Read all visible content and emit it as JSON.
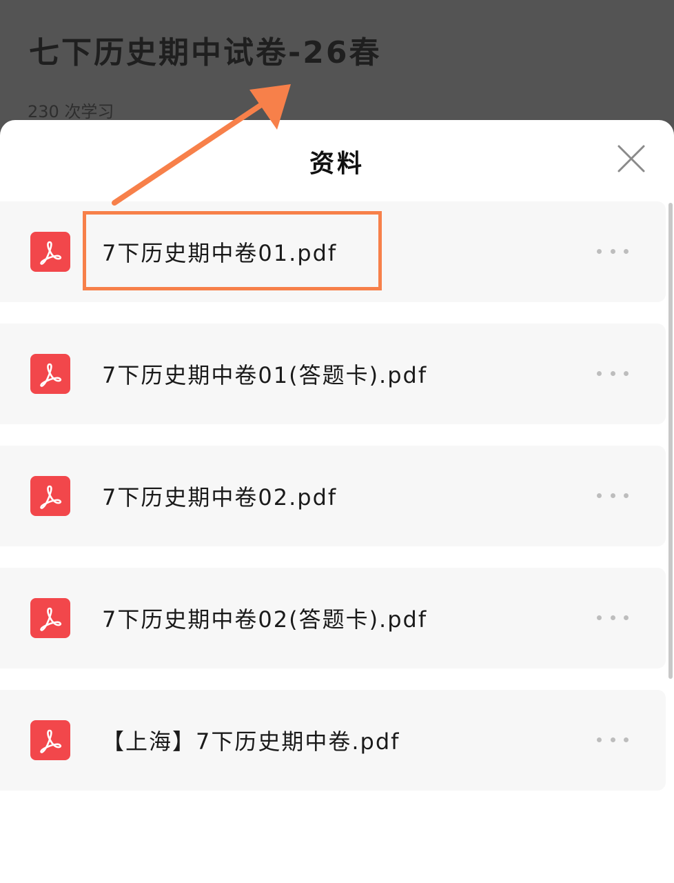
{
  "background": {
    "title": "七下历史期中试卷-26春",
    "study_count": "230 次学习"
  },
  "sheet": {
    "title": "资料",
    "files": [
      {
        "name": "7下历史期中卷01.pdf"
      },
      {
        "name": "7下历史期中卷01(答题卡).pdf"
      },
      {
        "name": "7下历史期中卷02.pdf"
      },
      {
        "name": "7下历史期中卷02(答题卡).pdf"
      },
      {
        "name": "【上海】7下历史期中卷.pdf"
      }
    ]
  },
  "icons": {
    "file": "pdf-icon",
    "close": "close-icon",
    "more": "more-icon"
  },
  "colors": {
    "pdf_red": "#f2474b",
    "annotation_orange": "#f7804a"
  }
}
